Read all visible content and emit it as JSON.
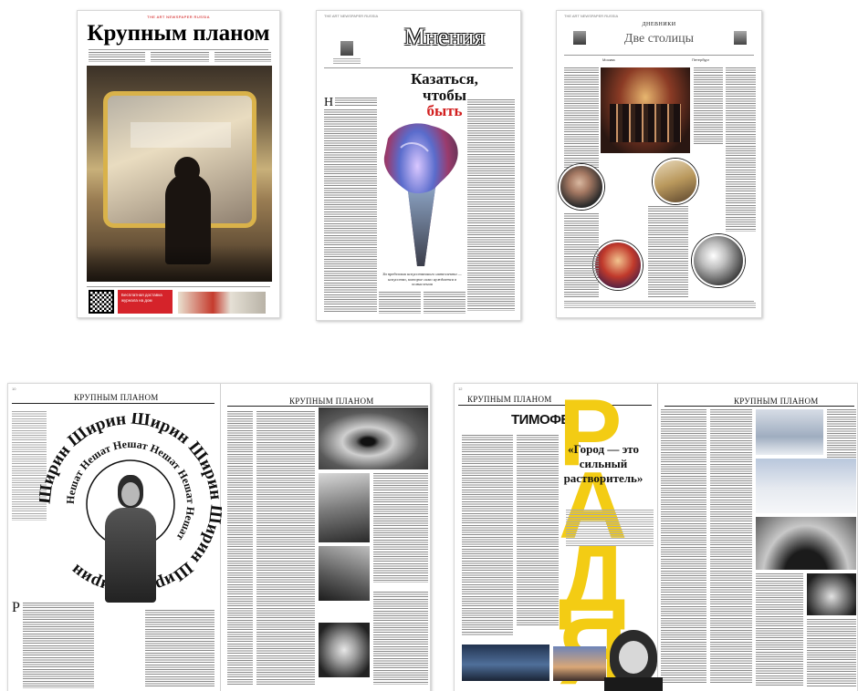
{
  "page1": {
    "logo": "THE ART NEWSPAPER RUSSIA",
    "title": "Крупным планом",
    "qr_label": "QR",
    "ad_text": "Бесплатная доставка журнала на дом"
  },
  "page2": {
    "title": "Мнения",
    "headline_1": "Казаться,",
    "headline_2": "чтобы",
    "headline_3": "быть",
    "drop_cap": "Н",
    "quote": "За пределами искусственного интеллекта — искусство, которое само нуждается в осмыслении"
  },
  "page3": {
    "section": "ДНЕВНИКИ",
    "title": "Две столицы",
    "left_label": "Москва",
    "right_label": "Петербург"
  },
  "spread1": {
    "section_left": "КРУПНЫМ ПЛАНОМ",
    "section_right": "КРУПНЫМ ПЛАНОМ",
    "ring_outer": "Ширин Ширин Ширин Ширин Ширин Ширин Ширин ",
    "ring_inner": "Нешат Нешат Нешат Нешат Нешат Нешат ",
    "drop_cap": "Р"
  },
  "spread2": {
    "section_left": "КРУПНЫМ ПЛАНОМ",
    "section_right": "КРУПНЫМ ПЛАНОМ",
    "name_first": "ТИМОФЕЙ",
    "name_last": "РАДЯ",
    "quote": "«Город — это сильный растворитель»",
    "accent": "#f3cc14"
  }
}
